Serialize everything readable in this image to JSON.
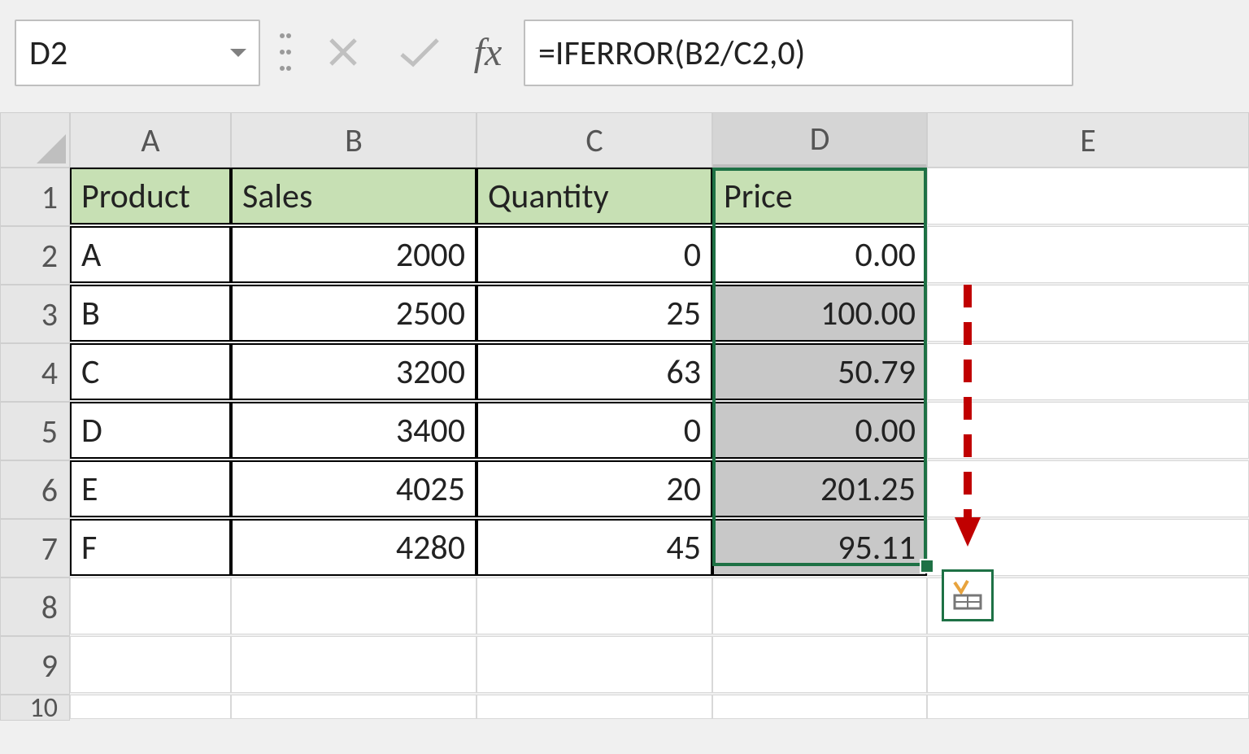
{
  "name_box": {
    "value": "D2"
  },
  "formula_bar": {
    "value": "=IFERROR(B2/C2,0)",
    "fx_label": "fx"
  },
  "columns": [
    "A",
    "B",
    "C",
    "D",
    "E"
  ],
  "row_numbers": [
    "1",
    "2",
    "3",
    "4",
    "5",
    "6",
    "7",
    "8",
    "9",
    "10"
  ],
  "headers": {
    "a": "Product",
    "b": "Sales",
    "c": "Quantity",
    "d": "Price"
  },
  "data": [
    {
      "product": "A",
      "sales": "2000",
      "quantity": "0",
      "price": "0.00"
    },
    {
      "product": "B",
      "sales": "2500",
      "quantity": "25",
      "price": "100.00"
    },
    {
      "product": "C",
      "sales": "3200",
      "quantity": "63",
      "price": "50.79"
    },
    {
      "product": "D",
      "sales": "3400",
      "quantity": "0",
      "price": "0.00"
    },
    {
      "product": "E",
      "sales": "4025",
      "quantity": "20",
      "price": "201.25"
    },
    {
      "product": "F",
      "sales": "4280",
      "quantity": "45",
      "price": "95.11"
    }
  ],
  "selection": {
    "range": "D2:D7"
  }
}
